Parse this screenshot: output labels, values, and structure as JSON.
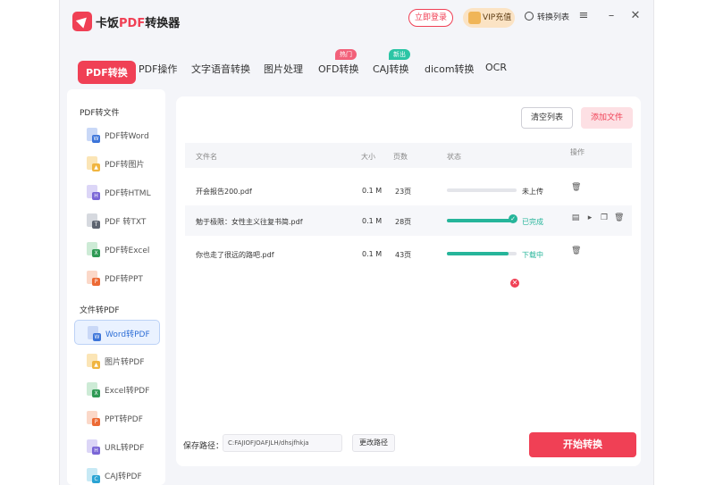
{
  "app": {
    "name_prefix": "卡饭",
    "name_pdf": "PDF",
    "name_suffix": "转换器"
  },
  "header": {
    "login": "立即登录",
    "vip": "VIP充值",
    "convert_list": "转换列表"
  },
  "tabs": [
    {
      "label": "PDF转换"
    },
    {
      "label": "PDF操作"
    },
    {
      "label": "文字语音转换"
    },
    {
      "label": "图片处理"
    },
    {
      "label": "OFD转换",
      "badge": "热门"
    },
    {
      "label": "CAJ转换",
      "badge": "新出"
    },
    {
      "label": "dicom转换"
    },
    {
      "label": "OCR"
    }
  ],
  "sidebar": {
    "section1": "PDF转文件",
    "items1": [
      {
        "label": "PDF转Word",
        "icon": "W"
      },
      {
        "label": "PDF转图片",
        "icon": "▲"
      },
      {
        "label": "PDF转HTML",
        "icon": "H"
      },
      {
        "label": "PDF 转TXT",
        "icon": "T"
      },
      {
        "label": "PDF转Excel",
        "icon": "X"
      },
      {
        "label": "PDF转PPT",
        "icon": "P"
      }
    ],
    "section2": "文件转PDF",
    "items2": [
      {
        "label": "Word转PDF",
        "icon": "W"
      },
      {
        "label": "图片转PDF",
        "icon": "▲"
      },
      {
        "label": "Excel转PDF",
        "icon": "X"
      },
      {
        "label": "PPT转PDF",
        "icon": "P"
      },
      {
        "label": "URL转PDF",
        "icon": "H"
      },
      {
        "label": "CAJ转PDF",
        "icon": "C"
      }
    ]
  },
  "toolbar": {
    "clear": "清空列表",
    "add": "添加文件"
  },
  "table": {
    "headers": {
      "name": "文件名",
      "size": "大小",
      "pages": "页数",
      "status": "状态",
      "ops": "操作"
    },
    "rows": [
      {
        "name": "开会报告200.pdf",
        "size": "0.1 M",
        "pages": "23页",
        "progress": 0,
        "status": "未上传"
      },
      {
        "name": "勉于极限：女性主义往复书简.pdf",
        "size": "0.1 M",
        "pages": "28页",
        "progress": 1.0,
        "status": "已完成"
      },
      {
        "name": "你也走了很远的路吧.pdf",
        "size": "0.1 M",
        "pages": "43页",
        "progress": 0.88,
        "status": "下载中"
      }
    ]
  },
  "footer": {
    "save_label": "保存路径：",
    "save_path": "C:FAJIOFJOAFJLH/dhsjfhkja",
    "change": "更改路径",
    "start": "开始转换"
  },
  "colors": {
    "accent": "#f04055",
    "success": "#26b59a",
    "active_blue": "#2f6fd6"
  }
}
